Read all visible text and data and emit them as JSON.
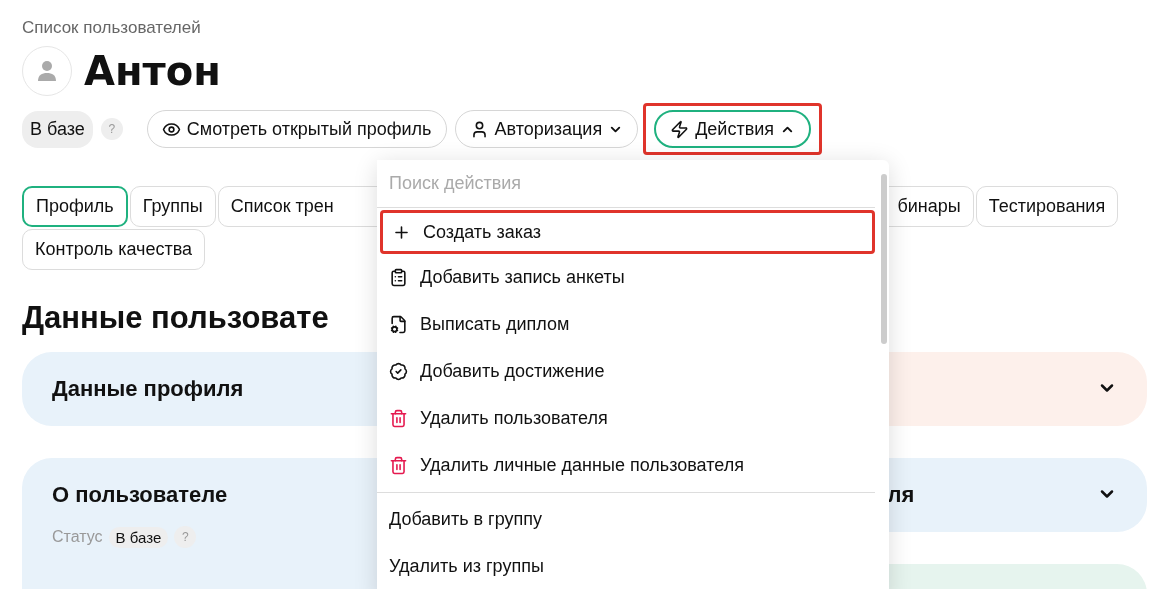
{
  "breadcrumb": "Список пользователей",
  "user": {
    "name": "Антон"
  },
  "status_badge": {
    "label": "В базе",
    "help": "?"
  },
  "buttons": [
    {
      "kind": "eye",
      "label": "Смотреть открытый профиль",
      "active": false
    },
    {
      "kind": "person",
      "label": "Авторизация",
      "expanded": false,
      "active": false
    },
    {
      "kind": "bolt",
      "label": "Действия",
      "expanded": true,
      "highlighted": true,
      "active": true
    }
  ],
  "tabs": [
    {
      "label": "Профиль",
      "selected": true,
      "kind": "full"
    },
    {
      "label": "Группы",
      "selected": false,
      "kind": "full"
    },
    {
      "label": "Список трен",
      "selected": false,
      "kind": "cut-right"
    },
    {
      "label": "бинары",
      "selected": false,
      "kind": "cut-left"
    },
    {
      "label": "Тестирования",
      "selected": false,
      "kind": "full"
    },
    {
      "label": "Контроль качества",
      "selected": false,
      "kind": "full"
    }
  ],
  "section_title": "Данные пользовате",
  "cards": [
    {
      "title": "Данные профиля",
      "color": "#e8f2fa",
      "cut": false
    },
    {
      "color": "#fdf0eb",
      "chevron": true
    },
    {
      "title": "О пользователе",
      "color": "#e8f2fa",
      "cut": false,
      "status": {
        "label": "Статус",
        "value": "В базе",
        "help": "?"
      }
    },
    {
      "title": "ля",
      "color": "#e8f2fa",
      "chevron": true,
      "cut": true
    },
    {
      "color": "#e6f4ee"
    }
  ],
  "menu": {
    "search": {
      "placeholder": "Поиск действия"
    },
    "groups": [
      [
        {
          "kind": "plus",
          "label": "Создать заказ",
          "highlighted": true
        },
        {
          "kind": "clipboard",
          "label": "Добавить запись анкеты",
          "highlighted": false
        },
        {
          "kind": "document",
          "label": "Выписать диплом",
          "highlighted": false
        },
        {
          "kind": "badge",
          "label": "Добавить достижение",
          "highlighted": false
        },
        {
          "kind": "trash",
          "label": "Удалить пользователя",
          "highlighted": false
        },
        {
          "kind": "trash",
          "label": "Удалить личные данные пользователя",
          "highlighted": false
        }
      ],
      [
        {
          "kind": "plain",
          "label": "Добавить в группу",
          "highlighted": false
        },
        {
          "kind": "plain",
          "label": "Удалить из группы",
          "highlighted": false
        }
      ]
    ]
  }
}
